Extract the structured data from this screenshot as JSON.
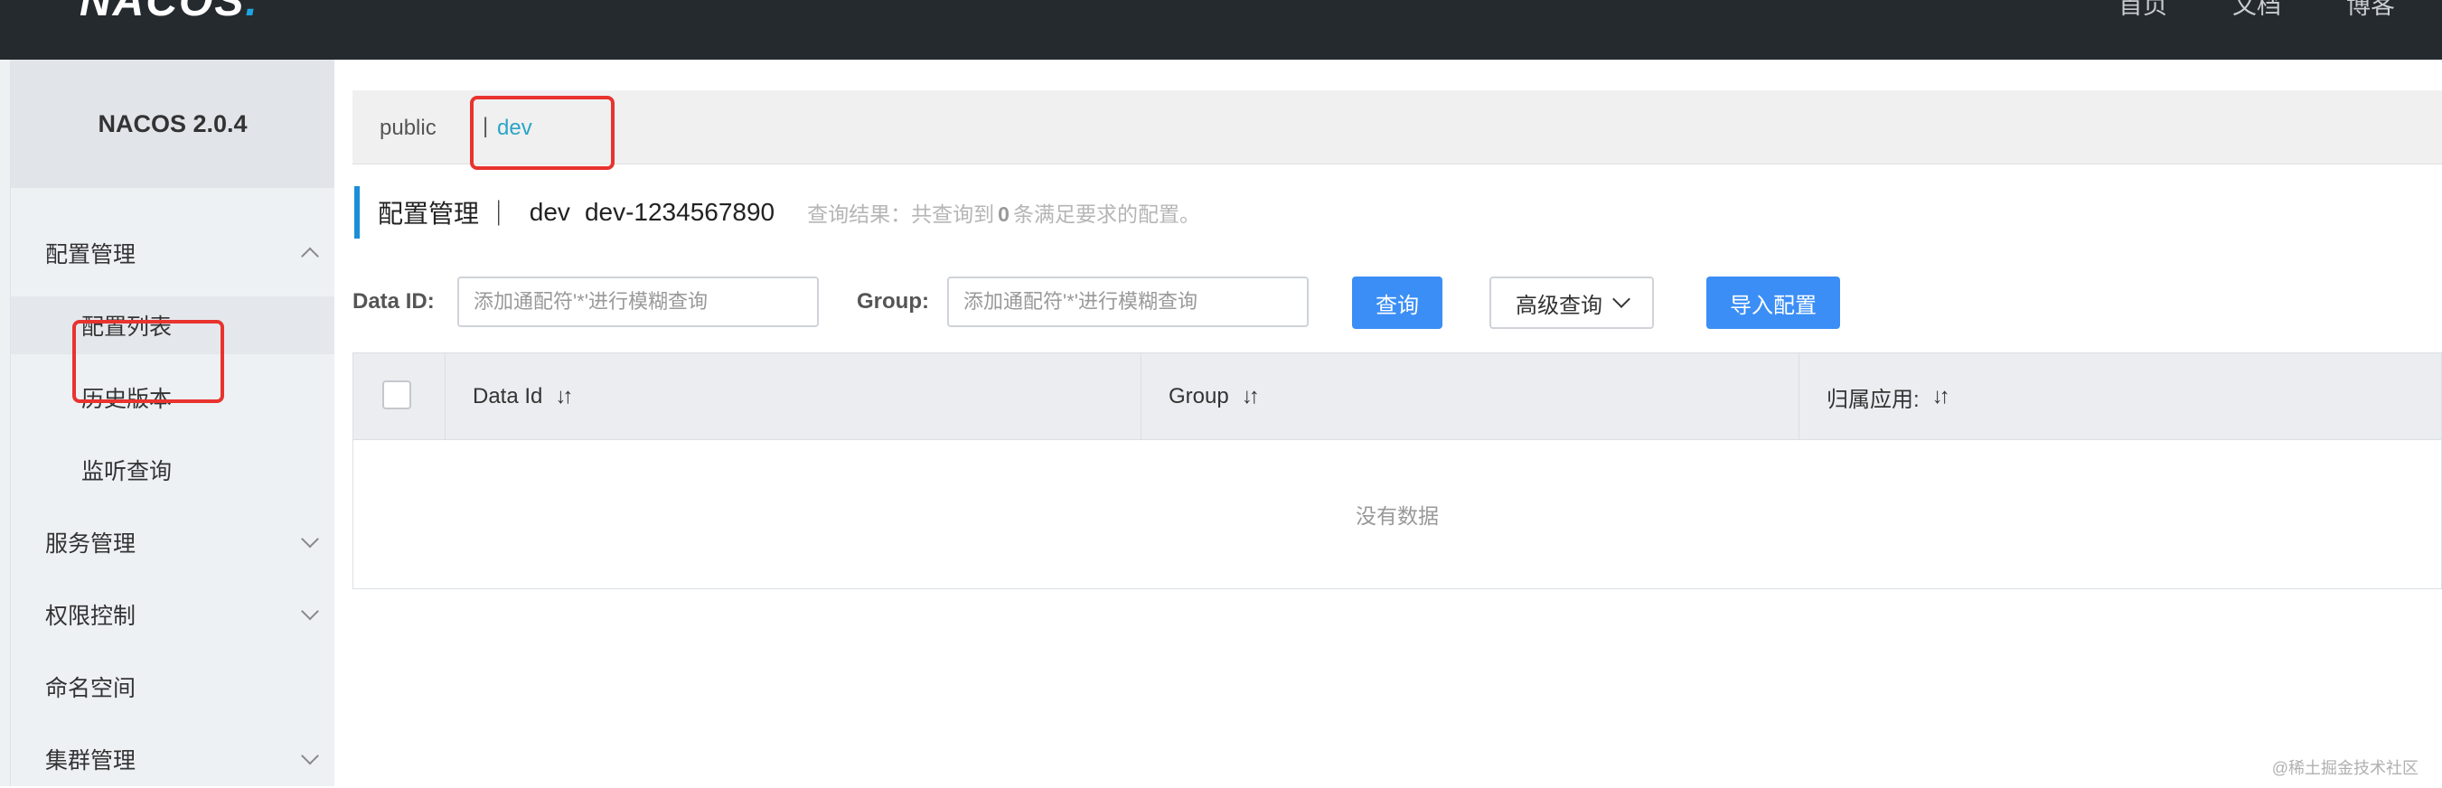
{
  "header": {
    "logo_text": "NACOS",
    "logo_dot": ".",
    "nav": [
      "首页",
      "文档",
      "博客"
    ]
  },
  "sidebar": {
    "title": "NACOS 2.0.4",
    "items": [
      {
        "label": "配置管理"
      },
      {
        "label": "配置列表"
      },
      {
        "label": "历史版本"
      },
      {
        "label": "监听查询"
      },
      {
        "label": "服务管理"
      },
      {
        "label": "权限控制"
      },
      {
        "label": "命名空间"
      },
      {
        "label": "集群管理"
      }
    ]
  },
  "namespace_bar": {
    "public": "public",
    "separator": "|",
    "dev": "dev"
  },
  "title_row": {
    "title": "配置管理 ｜",
    "namespace": "dev",
    "namespace_id": "dev-1234567890",
    "result_prefix": "查询结果：共查询到",
    "result_count": "0",
    "result_suffix": "条满足要求的配置。"
  },
  "filters": {
    "data_id_label": "Data ID:",
    "data_id_placeholder": "添加通配符'*'进行模糊查询",
    "group_label": "Group:",
    "group_placeholder": "添加通配符'*'进行模糊查询",
    "query_button": "查询",
    "advanced_query": "高级查询",
    "import_button": "导入配置"
  },
  "table": {
    "columns": [
      "Data Id",
      "Group",
      "归属应用:"
    ],
    "sort_glyph": "↓↑",
    "empty_text": "没有数据"
  },
  "watermark": "@稀土掘金技术社区",
  "colors": {
    "topbar": "#252a2f",
    "accent": "#3a8ef6",
    "highlight_box": "#e8332e",
    "namespace_active": "#2aa5c6"
  }
}
